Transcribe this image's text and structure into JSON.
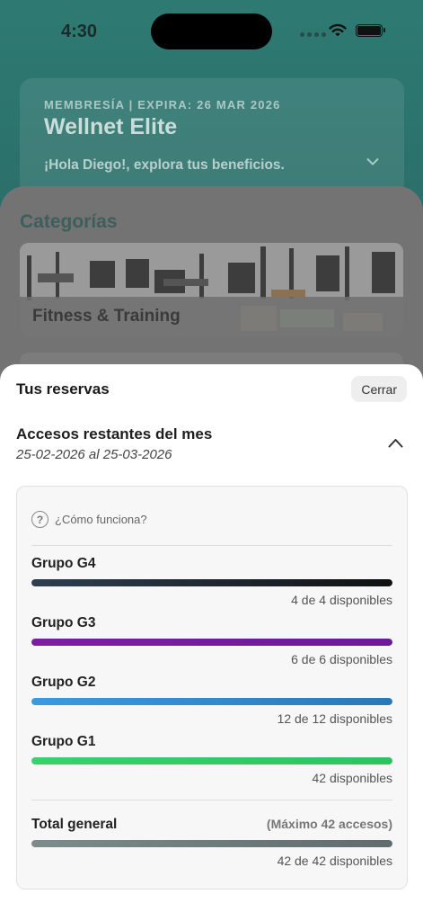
{
  "status_bar": {
    "time": "4:30"
  },
  "membership": {
    "meta": "MEMBRESÍA | EXPIRA: 26 MAR 2026",
    "plan": "Wellnet Elite",
    "greeting": "¡Hola Diego!, explora tus beneficios."
  },
  "categories": {
    "title": "Categorías",
    "items": [
      {
        "label": "Fitness & Training"
      }
    ]
  },
  "reservations": {
    "title": "Tus reservas",
    "close_label": "Cerrar",
    "access_title": "Accesos restantes del mes",
    "access_range": "25-02-2026 al 25-03-2026",
    "help_text": "¿Cómo funciona?",
    "groups": [
      {
        "name": "Grupo G4",
        "availability": "4 de 4 disponibles",
        "remaining_fraction": 1.0,
        "color_start": "#2e3f52",
        "color_end": "#111111"
      },
      {
        "name": "Grupo G3",
        "availability": "6 de 6 disponibles",
        "remaining_fraction": 1.0,
        "color_start": "#7a1fa3",
        "color_end": "#6a1b9a"
      },
      {
        "name": "Grupo G2",
        "availability": "12 de 12 disponibles",
        "remaining_fraction": 1.0,
        "color_start": "#3a9be0",
        "color_end": "#2a78b8"
      },
      {
        "name": "Grupo G1",
        "availability": "42 disponibles",
        "remaining_fraction": 1.0,
        "color_start": "#3bd06e",
        "color_end": "#2ec262"
      }
    ],
    "total": {
      "name": "Total general",
      "max_label": "(Máximo 42 accesos)",
      "availability": "42 de 42 disponibles",
      "remaining_fraction": 1.0,
      "color_start": "#7d8b8b",
      "color_end": "#5f6b6f"
    }
  }
}
